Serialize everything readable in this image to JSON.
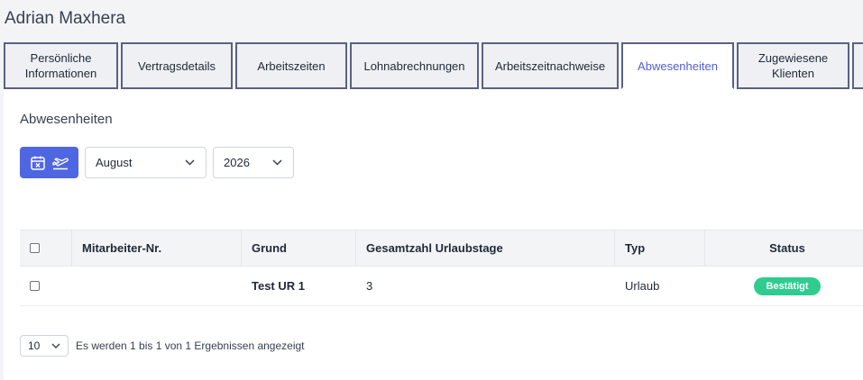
{
  "header": {
    "title": "Adrian Maxhera"
  },
  "tabs": [
    {
      "line1": "Persönliche",
      "line2": "Informationen",
      "active": false
    },
    {
      "line1": "Vertragsdetails",
      "line2": "",
      "active": false
    },
    {
      "line1": "Arbeitszeiten",
      "line2": "",
      "active": false
    },
    {
      "line1": "Lohnabrechnungen",
      "line2": "",
      "active": false
    },
    {
      "line1": "Arbeitszeitnachweise",
      "line2": "",
      "active": false
    },
    {
      "line1": "Abwesenheiten",
      "line2": "",
      "active": true
    },
    {
      "line1": "Zugewiesene",
      "line2": "Klienten",
      "active": false
    }
  ],
  "main": {
    "section_title": "Abwesenheiten",
    "add_button_icons": [
      "calendar-cross-icon",
      "plane-departure-icon"
    ],
    "month_select": "August",
    "year_select": "2026"
  },
  "table": {
    "headers": [
      "Mitarbeiter-Nr.",
      "Grund",
      "Gesamtzahl Urlaubstage",
      "Typ",
      "Status"
    ],
    "rows": [
      {
        "nr": "",
        "grund": "Test UR 1",
        "total": "3",
        "typ": "Urlaub",
        "status": "Bestätigt"
      }
    ]
  },
  "pagination": {
    "page_size": "10",
    "info": "Es werden 1 bis 1 von 1 Ergebnissen angezeigt"
  },
  "colors": {
    "accent": "#4f66e3",
    "active_tab_text": "#4f5fd8",
    "status_confirmed": "#2ecc8f"
  }
}
